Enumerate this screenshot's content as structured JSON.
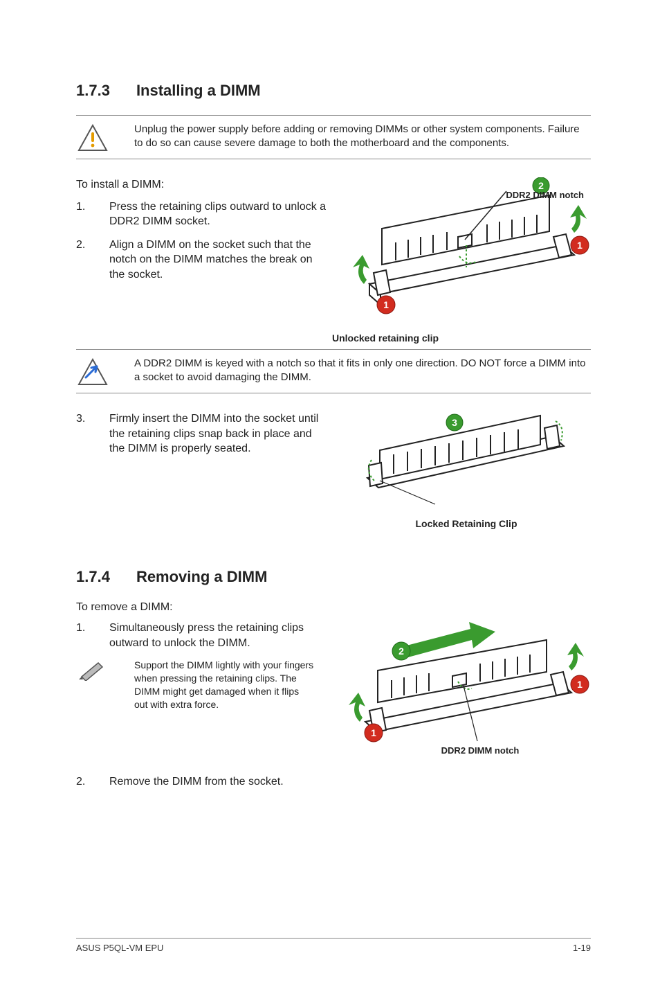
{
  "section173": {
    "number": "1.7.3",
    "title": "Installing a DIMM"
  },
  "warning173": "Unplug the power supply before adding or removing DIMMs or other system components. Failure to do so can cause severe damage to both the motherboard and the components.",
  "install_intro": "To install a DIMM:",
  "install_steps": [
    {
      "n": "1.",
      "t": "Press the retaining clips outward to unlock a DDR2 DIMM socket."
    },
    {
      "n": "2.",
      "t": "Align a DIMM on the socket such that the notch on the DIMM matches the break on the socket."
    }
  ],
  "fig1": {
    "top_label": "DDR2 DIMM notch",
    "caption": "Unlocked retaining clip",
    "badge2": "2",
    "badge1a": "1",
    "badge1b": "1"
  },
  "caution173": "A DDR2 DIMM is keyed with a notch so that it fits in only one direction. DO NOT force a DIMM into a socket to avoid damaging the DIMM.",
  "install_step3": {
    "n": "3.",
    "t": "Firmly insert the DIMM into the socket until the retaining clips snap back in place and the DIMM is properly seated."
  },
  "fig2": {
    "caption": "Locked Retaining Clip",
    "badge3": "3"
  },
  "section174": {
    "number": "1.7.4",
    "title": "Removing a DIMM"
  },
  "remove_intro": "To remove a DIMM:",
  "remove_step1": {
    "n": "1.",
    "t": "Simultaneously press the retaining clips outward to unlock the DIMM."
  },
  "note174": "Support the DIMM lightly with your fingers when pressing the retaining clips. The DIMM might get damaged when it flips out with extra force.",
  "fig3": {
    "label": "DDR2 DIMM notch",
    "badge2": "2",
    "badge1a": "1",
    "badge1b": "1"
  },
  "remove_step2": {
    "n": "2.",
    "t": "Remove the DIMM from the socket."
  },
  "footer": {
    "product": "ASUS P5QL-VM EPU",
    "page": "1-19"
  }
}
